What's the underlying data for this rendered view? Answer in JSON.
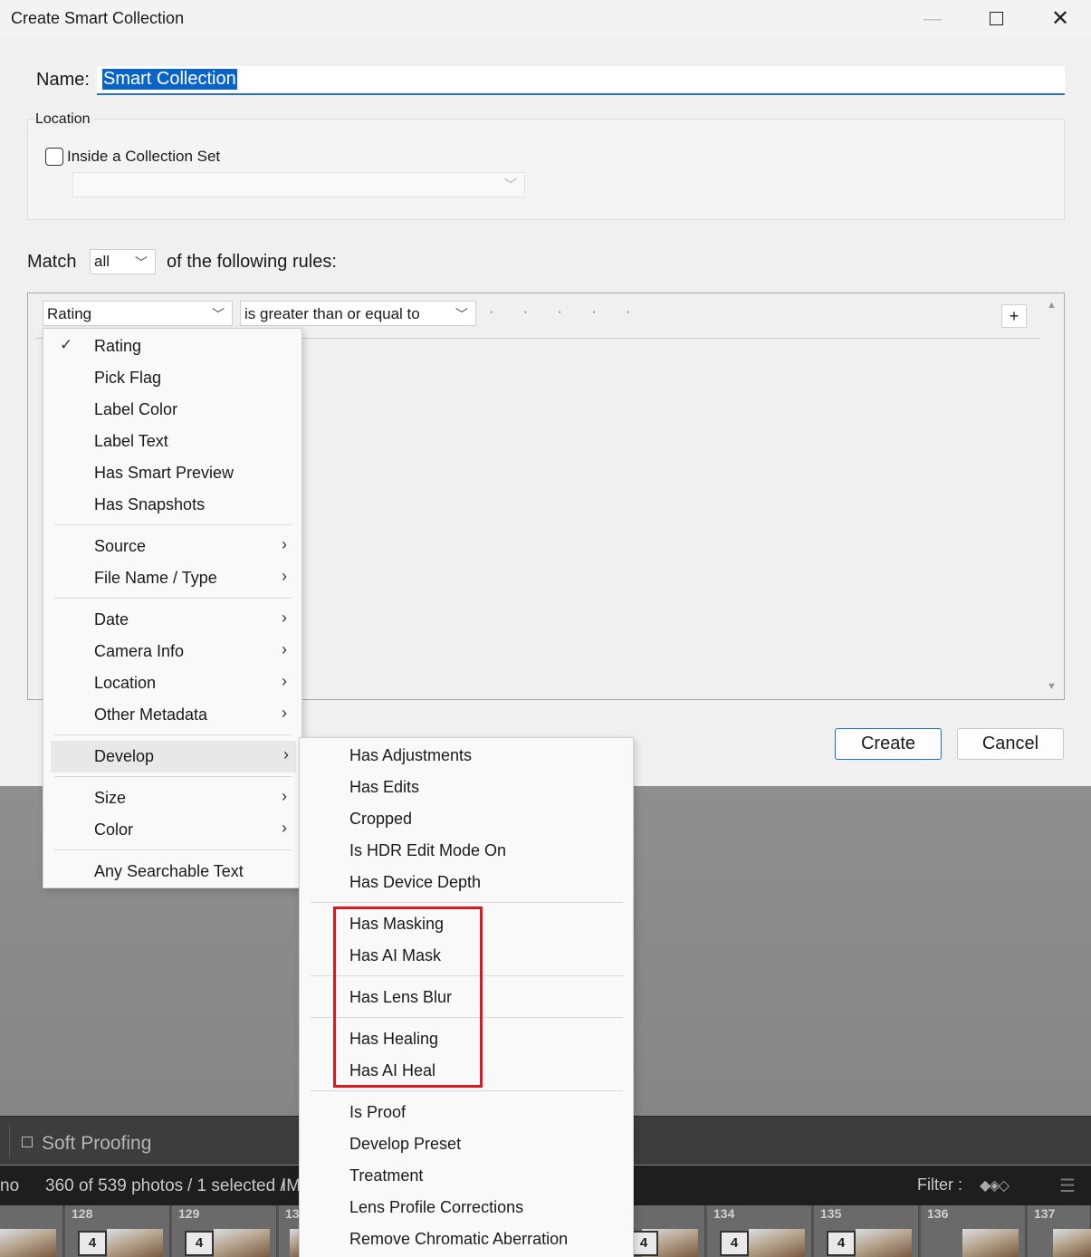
{
  "dialog": {
    "title": "Create Smart Collection",
    "name_label": "Name:",
    "name_value": "Smart Collection",
    "location_title": "Location",
    "inside_set_label": "Inside a Collection Set",
    "match_label": "Match",
    "match_value": "all",
    "match_suffix": "of the following rules:",
    "rule": {
      "field": "Rating",
      "operator": "is greater than or equal to",
      "dots": "· · · · ·",
      "add_label": "+"
    },
    "create_label": "Create",
    "cancel_label": "Cancel"
  },
  "main_menu": {
    "items": [
      {
        "label": "Rating",
        "checked": true
      },
      {
        "label": "Pick Flag"
      },
      {
        "label": "Label Color"
      },
      {
        "label": "Label Text"
      },
      {
        "label": "Has Smart Preview"
      },
      {
        "label": "Has Snapshots"
      },
      {
        "label": "Source",
        "submenu": true
      },
      {
        "label": "File Name / Type",
        "submenu": true
      },
      {
        "label": "Date",
        "submenu": true
      },
      {
        "label": "Camera Info",
        "submenu": true
      },
      {
        "label": "Location",
        "submenu": true
      },
      {
        "label": "Other Metadata",
        "submenu": true
      },
      {
        "label": "Develop",
        "submenu": true,
        "highlighted": true
      },
      {
        "label": "Size",
        "submenu": true
      },
      {
        "label": "Color",
        "submenu": true
      },
      {
        "label": "Any Searchable Text"
      }
    ]
  },
  "develop_menu": {
    "items": [
      {
        "label": "Has Adjustments"
      },
      {
        "label": "Has Edits"
      },
      {
        "label": "Cropped"
      },
      {
        "label": "Is HDR Edit Mode On"
      },
      {
        "label": "Has Device Depth"
      },
      {
        "label": "Has Masking"
      },
      {
        "label": "Has AI Mask"
      },
      {
        "label": "Has Lens Blur"
      },
      {
        "label": "Has Healing"
      },
      {
        "label": "Has AI Heal"
      },
      {
        "label": "Is Proof"
      },
      {
        "label": "Develop Preset"
      },
      {
        "label": "Treatment"
      },
      {
        "label": "Lens Profile Corrections"
      },
      {
        "label": "Remove Chromatic Aberration"
      }
    ]
  },
  "background": {
    "soft_proofing": "Soft Proofing",
    "status_left": "no",
    "status_count": "360 of 539 photos",
    "status_selected": "/ 1 selected /",
    "status_tail": "IM",
    "filter_label": "Filter :",
    "filmstrip": [
      {
        "num": "",
        "badge": ""
      },
      {
        "num": "128",
        "badge": "4"
      },
      {
        "num": "129",
        "badge": "4"
      },
      {
        "num": "13",
        "badge": ""
      },
      {
        "num": "",
        "badge": "4"
      },
      {
        "num": "134",
        "badge": "4"
      },
      {
        "num": "135",
        "badge": "4"
      },
      {
        "num": "136",
        "badge": ""
      },
      {
        "num": "137",
        "badge": ""
      }
    ]
  },
  "colors": {
    "accent": "#0a64c8",
    "highlight_box": "#e0161e"
  }
}
